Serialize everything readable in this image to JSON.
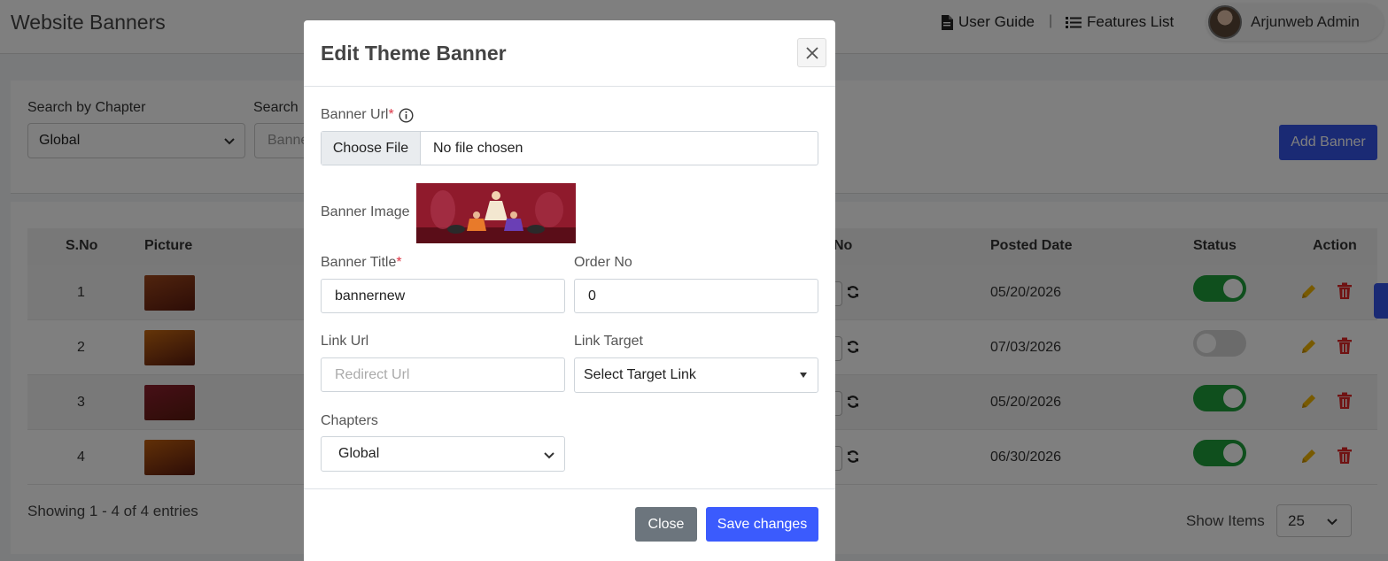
{
  "header": {
    "title": "Website Banners",
    "user_guide": "User Guide",
    "separator": "|",
    "features_list": "Features List",
    "user_name": "Arjunweb Admin"
  },
  "filters": {
    "chapter_label": "Search by Chapter",
    "chapter_value": "Global",
    "search_label": "Search",
    "search_placeholder": "Banne",
    "add_button": "Add Banner"
  },
  "table": {
    "columns": [
      "S.No",
      "Picture",
      "No",
      "Posted Date",
      "Status",
      "Action"
    ],
    "rows": [
      {
        "sno": "1",
        "date": "05/20/2026",
        "active": true,
        "thumb_color": "#a0481c"
      },
      {
        "sno": "2",
        "date": "07/03/2026",
        "active": false,
        "thumb_color": "#c96a12"
      },
      {
        "sno": "3",
        "date": "05/20/2026",
        "active": true,
        "thumb_color": "#8e1f2e"
      },
      {
        "sno": "4",
        "date": "06/30/2026",
        "active": true,
        "thumb_color": "#c2600e"
      }
    ],
    "showing": "Showing 1 - 4 of 4 entries",
    "show_items_label": "Show Items",
    "show_items_value": "25"
  },
  "modal": {
    "title": "Edit Theme Banner",
    "banner_url_label": "Banner Url",
    "required_mark": "*",
    "choose_file": "Choose File",
    "no_file": "No file chosen",
    "banner_image_label": "Banner Image",
    "banner_title_label": "Banner Title",
    "banner_title_value": "bannernew",
    "order_no_label": "Order No",
    "order_no_value": "0",
    "link_url_label": "Link Url",
    "link_url_placeholder": "Redirect Url",
    "link_target_label": "Link Target",
    "link_target_value": "Select Target Link",
    "chapters_label": "Chapters",
    "chapters_value": "Global",
    "close_button": "Close",
    "save_button": "Save changes"
  },
  "colors": {
    "primary": "#3554e8",
    "toggle_on": "#1e9e3a",
    "toggle_off": "#d6d6d6",
    "edit_icon": "#f0b400",
    "delete_icon": "#e02424",
    "secondary": "#6c757d"
  }
}
